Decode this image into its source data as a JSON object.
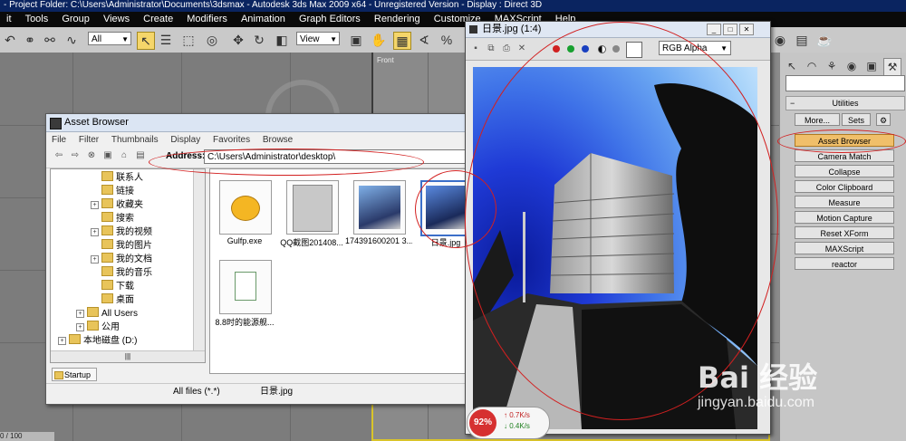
{
  "titlebar": {
    "text": "- Project Folder: C:\\Users\\Administrator\\Documents\\3dsmax     - Autodesk 3ds Max  2009 x64  - Unregistered Version     - Display : Direct 3D"
  },
  "menubar": {
    "items": [
      "it",
      "Tools",
      "Group",
      "Views",
      "Create",
      "Modifiers",
      "Animation",
      "Graph Editors",
      "Rendering",
      "Customize",
      "MAXScript",
      "Help"
    ]
  },
  "toolbar": {
    "selection_filter": "All",
    "ref_coord": "View"
  },
  "viewport": {
    "label": "Front"
  },
  "asset_browser": {
    "title": "Asset Browser",
    "menu": [
      "File",
      "Filter",
      "Thumbnails",
      "Display",
      "Favorites",
      "Browse"
    ],
    "address_label": "Address:",
    "address_value": "C:\\Users\\Administrator\\desktop\\",
    "tree": [
      {
        "label": "联系人",
        "indent": 1,
        "exp": ""
      },
      {
        "label": "链接",
        "indent": 1,
        "exp": ""
      },
      {
        "label": "收藏夹",
        "indent": 1,
        "exp": "+"
      },
      {
        "label": "搜索",
        "indent": 1,
        "exp": ""
      },
      {
        "label": "我的视频",
        "indent": 1,
        "exp": "+"
      },
      {
        "label": "我的图片",
        "indent": 1,
        "exp": ""
      },
      {
        "label": "我的文档",
        "indent": 1,
        "exp": "+"
      },
      {
        "label": "我的音乐",
        "indent": 1,
        "exp": ""
      },
      {
        "label": "下载",
        "indent": 1,
        "exp": ""
      },
      {
        "label": "桌面",
        "indent": 1,
        "exp": ""
      },
      {
        "label": "All Users",
        "indent": 0,
        "exp": "+"
      },
      {
        "label": "公用",
        "indent": 0,
        "exp": "+"
      },
      {
        "label": "本地磁盘 (D:)",
        "indent": -1,
        "exp": "+"
      }
    ],
    "files": [
      {
        "label": "Gulfp.exe"
      },
      {
        "label": "QQ截图201408..."
      },
      {
        "label": "174391600201 3..."
      },
      {
        "label": "日景.jpg"
      },
      {
        "label": "8.8时的能源舰..."
      }
    ],
    "tab": "Startup",
    "status_filter": "All files (*.*)",
    "status_file": "日景.jpg"
  },
  "image_window": {
    "title": "日景.jpg (1:4)",
    "channel": "RGB Alpha"
  },
  "command_panel": {
    "rollout_title": "Utilities",
    "more_button": "More...",
    "sets_button": "Sets",
    "utilities": [
      "Asset Browser",
      "Camera Match",
      "Collapse",
      "Color Clipboard",
      "Measure",
      "Motion Capture",
      "Reset XForm",
      "MAXScript",
      "reactor"
    ],
    "active": "Asset Browser"
  },
  "network": {
    "percent": "92%",
    "up": "0.7K/s",
    "down": "0.4K/s"
  },
  "watermark": {
    "logo": "Bai  经验",
    "sub": "jingyan.baidu.com"
  },
  "status_left": "0 / 100",
  "colors": {
    "highlight": "#f0bf6a",
    "annotation": "#d22020",
    "viewport_border": "#d9c42a"
  }
}
